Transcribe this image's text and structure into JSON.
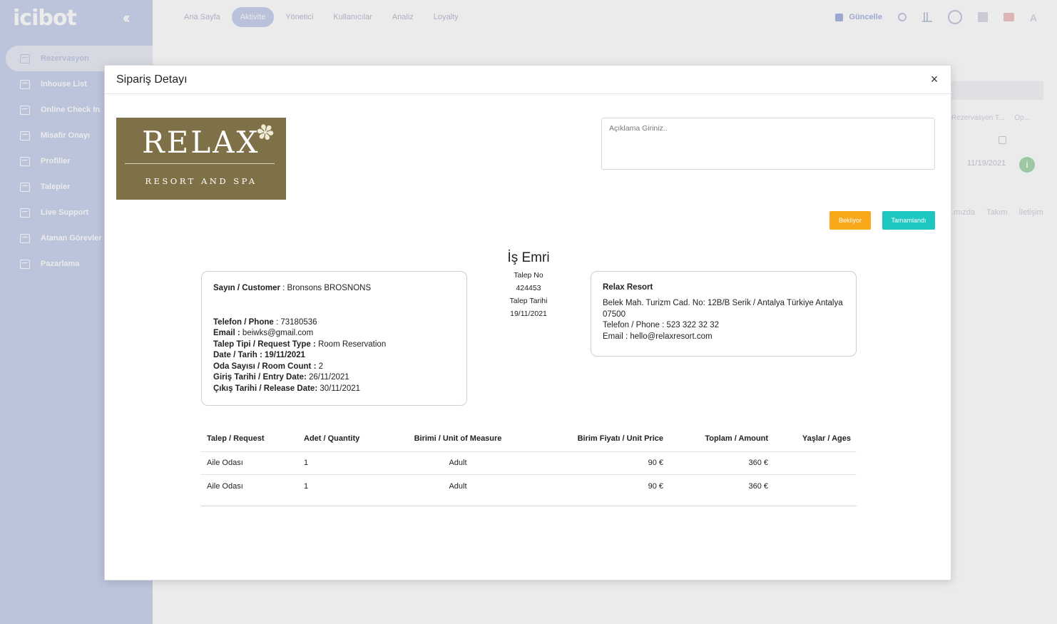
{
  "app": {
    "logo_text": "icibot",
    "collapse_icon": "chevron-double-left-icon"
  },
  "sidebar": {
    "items": [
      {
        "label": "Rezervasyon",
        "active": true
      },
      {
        "label": "Inhouse List"
      },
      {
        "label": "Online Check In"
      },
      {
        "label": "Misafir Onayı"
      },
      {
        "label": "Profiller"
      },
      {
        "label": "Talepler"
      },
      {
        "label": "Live Support"
      },
      {
        "label": "Atanan Görevler"
      },
      {
        "label": "Pazarlama"
      }
    ]
  },
  "topnav": {
    "tabs": [
      {
        "label": "Ana Sayfa"
      },
      {
        "label": "Aktivite",
        "active": true
      },
      {
        "label": "Yönetici"
      },
      {
        "label": "Kullanıcılar"
      },
      {
        "label": "Analiz"
      },
      {
        "label": "Loyalty"
      }
    ],
    "update_label": "Güncelle",
    "avatar_letter": "A"
  },
  "background": {
    "col_reservation": "Rezervasyon T...",
    "col_op": "Op...",
    "row_date": "11/19/2021",
    "footer_links": [
      "...mızda",
      "Takım",
      "İletişim"
    ]
  },
  "modal": {
    "title": "Sipariş Detayı",
    "close_symbol": "×",
    "brand": {
      "name": "RELAX",
      "subtitle": "RESORT AND SPA",
      "color": "#7f7147"
    },
    "note_placeholder": "Açıklama Giriniz..",
    "btn_wait": "Bekliyor",
    "btn_done": "Tamamlandı",
    "colors": {
      "wait": "#f9a81a",
      "done": "#1ec6c0"
    },
    "work_order": {
      "title": "İş Emri",
      "request_no_label": "Talep No",
      "request_no": "424453",
      "request_date_label": "Talep Tarihi",
      "request_date": "19/11/2021"
    },
    "customer": {
      "customer_label": "Sayın / Customer",
      "customer_value": "Bronsons BROSNONS",
      "phone_label": "Telefon / Phone",
      "phone_value": "73180536",
      "email_label": "Email :",
      "email_value": "beiwks@gmail.com",
      "type_label": "Talep Tipi / Request Type :",
      "type_value": "Room Reservation",
      "date_label": "Date / Tarih : 19/11/2021",
      "room_label": "Oda Sayısı / Room Count :",
      "room_value": "2",
      "entry_label": "Giriş Tarihi / Entry Date:",
      "entry_value": "26/11/2021",
      "release_label": "Çıkış Tarihi / Release Date:",
      "release_value": "30/11/2021"
    },
    "hotel": {
      "name": "Relax Resort",
      "address": "Belek Mah. Turizm Cad. No: 12B/B Serik / Antalya Türkiye Antalya 07500",
      "phone": "Telefon / Phone : 523 322 32 32",
      "email": "Email : hello@relaxresort.com"
    },
    "table": {
      "headers": [
        "Talep / Request",
        "Adet / Quantity",
        "Birimi / Unit of Measure",
        "Birim Fiyatı / Unit Price",
        "Toplam / Amount",
        "Yaşlar / Ages"
      ],
      "rows": [
        [
          "Aile Odası",
          "1",
          "Adult",
          "90 €",
          "360 €",
          ""
        ],
        [
          "Aile Odası",
          "1",
          "Adult",
          "90 €",
          "360 €",
          ""
        ]
      ]
    }
  }
}
